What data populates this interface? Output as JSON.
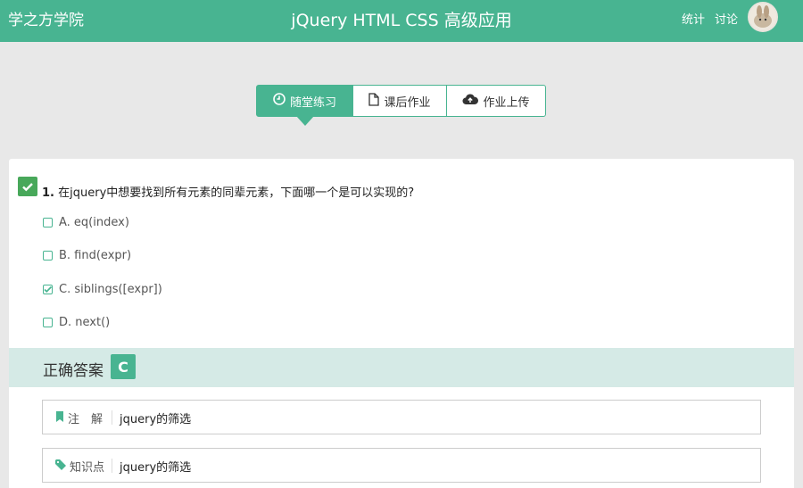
{
  "header": {
    "brand": "学之方学院",
    "title": "jQuery HTML CSS 高级应用",
    "nav": [
      "统计",
      "讨论"
    ]
  },
  "tabs": [
    {
      "label": "随堂练习",
      "icon": "clock-icon",
      "active": true
    },
    {
      "label": "课后作业",
      "icon": "file-icon",
      "active": false
    },
    {
      "label": "作业上传",
      "icon": "cloud-upload-icon",
      "active": false
    }
  ],
  "question": {
    "number": "1.",
    "text": "在jquery中想要找到所有元素的同辈元素，下面哪一个是可以实现的?",
    "options": [
      {
        "label": "A. eq(index)",
        "checked": false
      },
      {
        "label": "B. find(expr)",
        "checked": false
      },
      {
        "label": "C. siblings([expr])",
        "checked": true
      },
      {
        "label": "D. next()",
        "checked": false
      }
    ]
  },
  "answer": {
    "label": "正确答案",
    "value": "C"
  },
  "notes": [
    {
      "label": "注　解",
      "value": "jquery的筛选",
      "icon": "bookmark-icon"
    },
    {
      "label": "知识点",
      "value": "jquery的筛选",
      "icon": "tag-icon"
    }
  ],
  "colors": {
    "accent": "#48b491",
    "answer_bg": "#d5eae6",
    "check": "#48a85a"
  }
}
